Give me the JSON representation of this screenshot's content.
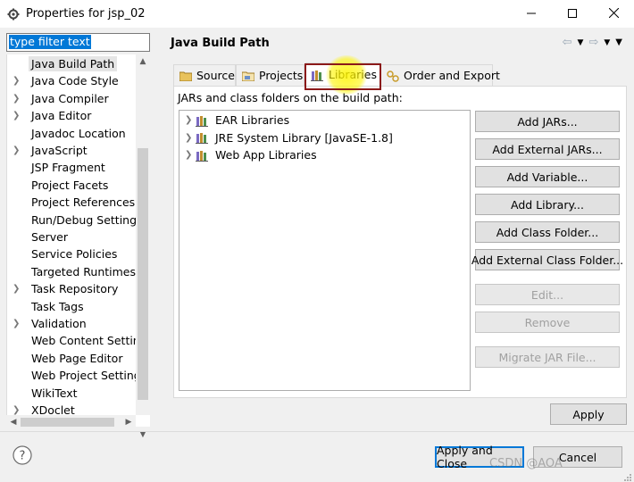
{
  "window": {
    "title": "Properties for jsp_02",
    "icon": "gear-icon",
    "controls": [
      "minimize-icon",
      "maximize-icon",
      "close-icon"
    ]
  },
  "filter": {
    "value": "type filter text"
  },
  "tree": {
    "items": [
      {
        "label": "Java Build Path",
        "expandable": false,
        "selected": true
      },
      {
        "label": "Java Code Style",
        "expandable": true
      },
      {
        "label": "Java Compiler",
        "expandable": true
      },
      {
        "label": "Java Editor",
        "expandable": true
      },
      {
        "label": "Javadoc Location",
        "expandable": false
      },
      {
        "label": "JavaScript",
        "expandable": true
      },
      {
        "label": "JSP Fragment",
        "expandable": false
      },
      {
        "label": "Project Facets",
        "expandable": false
      },
      {
        "label": "Project References",
        "expandable": false
      },
      {
        "label": "Run/Debug Settings",
        "expandable": false
      },
      {
        "label": "Server",
        "expandable": false
      },
      {
        "label": "Service Policies",
        "expandable": false
      },
      {
        "label": "Targeted Runtimes",
        "expandable": false
      },
      {
        "label": "Task Repository",
        "expandable": true
      },
      {
        "label": "Task Tags",
        "expandable": false
      },
      {
        "label": "Validation",
        "expandable": true
      },
      {
        "label": "Web Content Settings",
        "expandable": false
      },
      {
        "label": "Web Page Editor",
        "expandable": false
      },
      {
        "label": "Web Project Settings",
        "expandable": false
      },
      {
        "label": "WikiText",
        "expandable": false
      },
      {
        "label": "XDoclet",
        "expandable": true
      }
    ]
  },
  "page": {
    "title": "Java Build Path"
  },
  "tabs": [
    {
      "label": "Source",
      "icon": "source-folder-icon"
    },
    {
      "label": "Projects",
      "icon": "projects-icon"
    },
    {
      "label": "Libraries",
      "icon": "library-icon",
      "active": true
    },
    {
      "label": "Order and Export",
      "icon": "order-export-icon"
    }
  ],
  "libraries": {
    "label": "JARs and class folders on the build path:",
    "items": [
      {
        "label": "EAR Libraries"
      },
      {
        "label": "JRE System Library [JavaSE-1.8]"
      },
      {
        "label": "Web App Libraries"
      }
    ]
  },
  "buttons": {
    "add_jars": "Add JARs...",
    "add_external_jars": "Add External JARs...",
    "add_variable": "Add Variable...",
    "add_library": "Add Library...",
    "add_class_folder": "Add Class Folder...",
    "add_external_class_folder": "Add External Class Folder...",
    "edit": "Edit...",
    "remove": "Remove",
    "migrate_jar": "Migrate JAR File...",
    "apply": "Apply",
    "apply_and_close": "Apply and Close",
    "cancel": "Cancel"
  },
  "watermark": "CSDN @AOA",
  "colors": {
    "selection": "#0078d7",
    "highlight_box": "#8b1a1a",
    "cursor_spot": "#fff500"
  }
}
